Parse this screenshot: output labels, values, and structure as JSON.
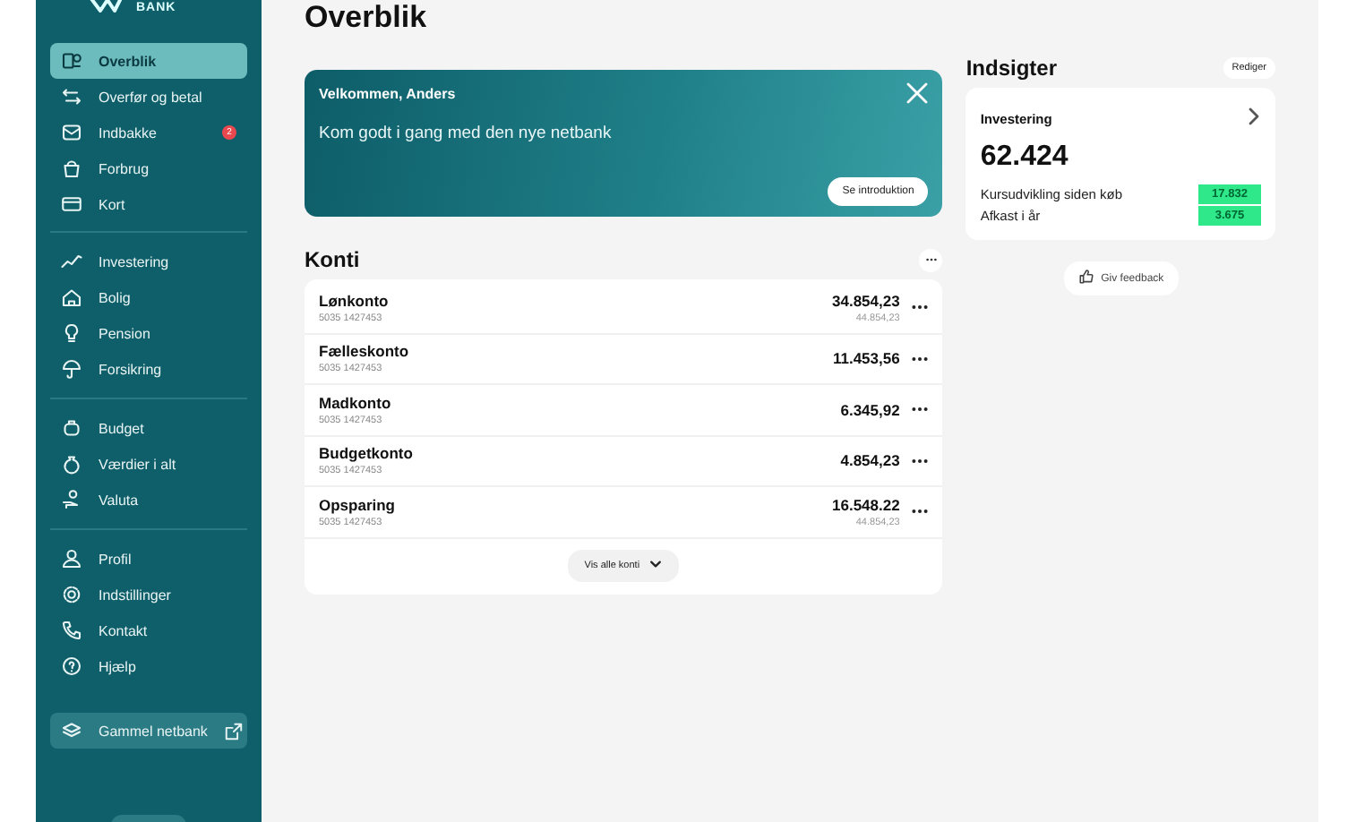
{
  "logo": {
    "text": "BANK"
  },
  "sidebar": {
    "groups": [
      {
        "items": [
          {
            "label": "Overblik",
            "selected": true
          },
          {
            "label": "Overfør og betal",
            "selected": false
          },
          {
            "label": "Indbakke",
            "selected": false,
            "badge": "2"
          },
          {
            "label": "Forbrug",
            "selected": false
          },
          {
            "label": "Kort",
            "selected": false
          }
        ]
      },
      {
        "items": [
          {
            "label": "Investering",
            "selected": false
          },
          {
            "label": "Bolig",
            "selected": false
          },
          {
            "label": "Pension",
            "selected": false
          },
          {
            "label": "Forsikring",
            "selected": false
          }
        ]
      },
      {
        "items": [
          {
            "label": "Budget",
            "selected": false
          },
          {
            "label": "Værdier i alt",
            "selected": false
          },
          {
            "label": "Valuta",
            "selected": false
          }
        ]
      },
      {
        "items": [
          {
            "label": "Profil",
            "selected": false
          },
          {
            "label": "Indstillinger",
            "selected": false
          },
          {
            "label": "Kontakt",
            "selected": false
          },
          {
            "label": "Hjælp",
            "selected": false
          }
        ]
      }
    ],
    "external_link": {
      "label": "Gammel netbank"
    }
  },
  "page": {
    "title": "Overblik"
  },
  "welcome": {
    "title": "Velkommen, Anders",
    "text": "Kom godt i gang med den nye netbank",
    "button": "Se introduktion"
  },
  "accounts": {
    "title": "Konti",
    "rows": [
      {
        "name": "Lønkonto",
        "number": "5035 1427453",
        "balance": "34.854,23",
        "available": "44.854,23"
      },
      {
        "name": "Fælleskonto",
        "number": "5035 1427453",
        "balance": "11.453,56"
      },
      {
        "name": "Madkonto",
        "number": "5035 1427453",
        "balance": "6.345,92"
      },
      {
        "name": "Budgetkonto",
        "number": "5035 1427453",
        "balance": "4.854,23"
      },
      {
        "name": "Opsparing",
        "number": "5035 1427453",
        "balance": "16.548.22",
        "available": "44.854,23"
      }
    ],
    "show_all": "Vis alle konti"
  },
  "insights": {
    "title": "Indsigter",
    "edit": "Rediger",
    "card": {
      "title": "Investering",
      "value": "62.424",
      "lines": [
        {
          "label": "Kursudvikling siden køb",
          "value": "17.832"
        },
        {
          "label": "Afkast i år",
          "value": "3.675"
        }
      ]
    },
    "feedback": "Giv feedback"
  }
}
